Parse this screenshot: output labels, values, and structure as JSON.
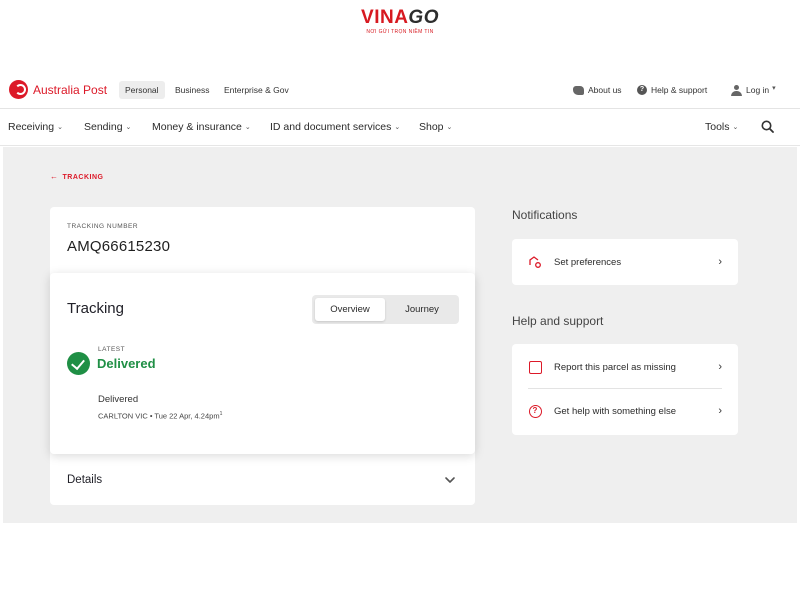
{
  "watermark": {
    "brand_a": "VINA",
    "brand_b": "GO",
    "tagline": "NƠI GỬI TRỌN NIỀM TIN"
  },
  "topbar": {
    "brand": "Australia Post",
    "segments": [
      "Personal",
      "Business",
      "Enterprise & Gov"
    ],
    "active_segment": "Personal",
    "about": "About us",
    "help": "Help & support",
    "login": "Log in"
  },
  "nav": {
    "items": [
      "Receiving",
      "Sending",
      "Money & insurance",
      "ID and document services",
      "Shop"
    ],
    "tools": "Tools"
  },
  "back_link": "TRACKING",
  "tracking": {
    "number_label": "TRACKING NUMBER",
    "number": "AMQ66615230",
    "title": "Tracking",
    "tabs": [
      "Overview",
      "Journey"
    ],
    "active_tab": "Overview",
    "latest_label": "LATEST",
    "status": "Delivered",
    "event_title": "Delivered",
    "event_meta": "CARLTON VIC • Tue 22 Apr, 4.24pm",
    "event_footnote": "1",
    "details_label": "Details"
  },
  "notifications": {
    "title": "Notifications",
    "items": [
      {
        "label": "Set preferences",
        "icon": "preferences-gear-icon"
      }
    ]
  },
  "help": {
    "title": "Help and support",
    "items": [
      {
        "label": "Report this parcel as missing",
        "icon": "parcel-missing-icon"
      },
      {
        "label": "Get help with something else",
        "icon": "question-icon"
      }
    ]
  },
  "colors": {
    "brand_red": "#dc1928",
    "success_green": "#1f8f45",
    "page_grey": "#efefef"
  }
}
